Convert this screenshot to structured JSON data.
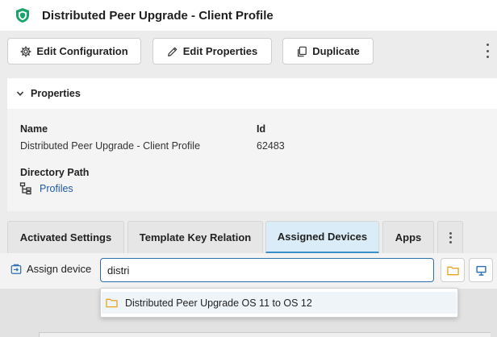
{
  "header": {
    "title": "Distributed Peer Upgrade - Client Profile",
    "icon": "shield-icon",
    "accent": "#1aa36a"
  },
  "toolbar": {
    "edit_configuration": "Edit Configuration",
    "edit_properties": "Edit Properties",
    "duplicate": "Duplicate"
  },
  "properties": {
    "header": "Properties",
    "name_label": "Name",
    "name_value": "Distributed Peer Upgrade - Client Profile",
    "id_label": "Id",
    "id_value": "62483",
    "path_label": "Directory Path",
    "path_value": "Profiles"
  },
  "tabs": [
    {
      "label": "Activated Settings",
      "active": false
    },
    {
      "label": "Template Key Relation",
      "active": false
    },
    {
      "label": "Assigned Devices",
      "active": true
    },
    {
      "label": "Apps",
      "active": false
    }
  ],
  "assign": {
    "label": "Assign device",
    "search_value": "distri"
  },
  "dropdown": {
    "items": [
      {
        "label": "Distributed Peer Upgrade OS 11 to OS 12",
        "icon": "folder-icon"
      }
    ]
  },
  "colors": {
    "link": "#1d5ba8",
    "active_tab": "#d9ecf7",
    "focus": "#2e6fb0",
    "folder": "#e8a321"
  }
}
